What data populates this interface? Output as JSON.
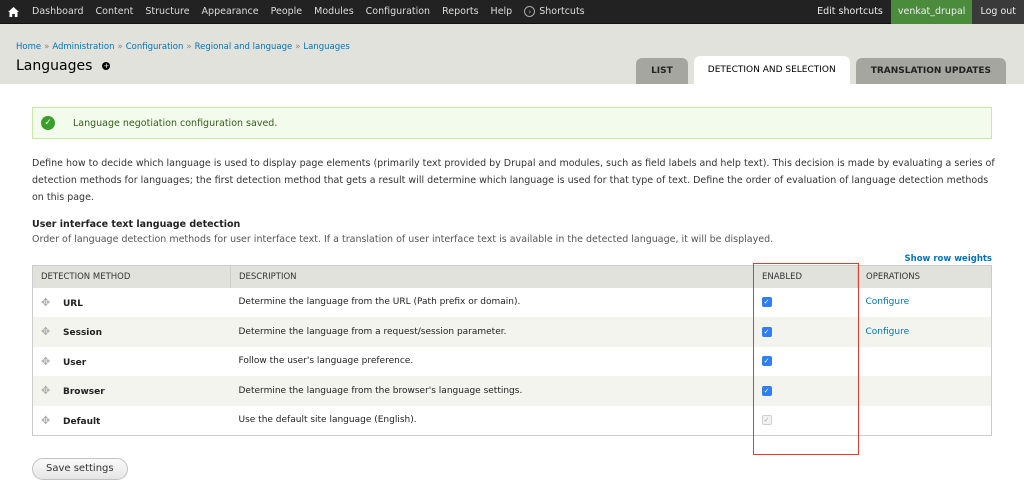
{
  "toolbar": {
    "nav": [
      "Dashboard",
      "Content",
      "Structure",
      "Appearance",
      "People",
      "Modules",
      "Configuration",
      "Reports",
      "Help"
    ],
    "shortcuts": "Shortcuts",
    "edit_shortcuts": "Edit shortcuts",
    "username": "venkat_drupal",
    "logout": "Log out"
  },
  "breadcrumb": [
    "Home",
    "Administration",
    "Configuration",
    "Regional and language",
    "Languages"
  ],
  "breadcrumb_separator": "»",
  "page_title": "Languages",
  "tabs": [
    {
      "label": "List",
      "active": false
    },
    {
      "label": "Detection and selection",
      "active": true
    },
    {
      "label": "Translation updates",
      "active": false
    }
  ],
  "status_message": "Language negotiation configuration saved.",
  "intro": "Define how to decide which language is used to display page elements (primarily text provided by Drupal and modules, such as field labels and help text). This decision is made by evaluating a series of detection methods for languages; the first detection method that gets a result will determine which language is used for that type of text. Define the order of evaluation of language detection methods on this page.",
  "section": {
    "title": "User interface text language detection",
    "description": "Order of language detection methods for user interface text. If a translation of user interface text is available in the detected language, it will be displayed."
  },
  "show_row_weights": "Show row weights",
  "table": {
    "headers": [
      "Detection method",
      "Description",
      "Enabled",
      "Operations"
    ],
    "rows": [
      {
        "method": "URL",
        "description": "Determine the language from the URL (Path prefix or domain).",
        "enabled": true,
        "disabled": false,
        "operation": "Configure"
      },
      {
        "method": "Session",
        "description": "Determine the language from a request/session parameter.",
        "enabled": true,
        "disabled": false,
        "operation": "Configure"
      },
      {
        "method": "User",
        "description": "Follow the user's language preference.",
        "enabled": true,
        "disabled": false,
        "operation": ""
      },
      {
        "method": "Browser",
        "description": "Determine the language from the browser's language settings.",
        "enabled": true,
        "disabled": false,
        "operation": ""
      },
      {
        "method": "Default",
        "description": "Use the default site language (English).",
        "enabled": true,
        "disabled": true,
        "operation": ""
      }
    ]
  },
  "save_button": "Save settings",
  "colors": {
    "toolbar_bg": "#222222",
    "user_bg": "#4a8b3c",
    "link": "#0074bd",
    "checkbox": "#2f7ef3",
    "highlight": "#e63a2c",
    "status_bg": "#f3fbec"
  }
}
